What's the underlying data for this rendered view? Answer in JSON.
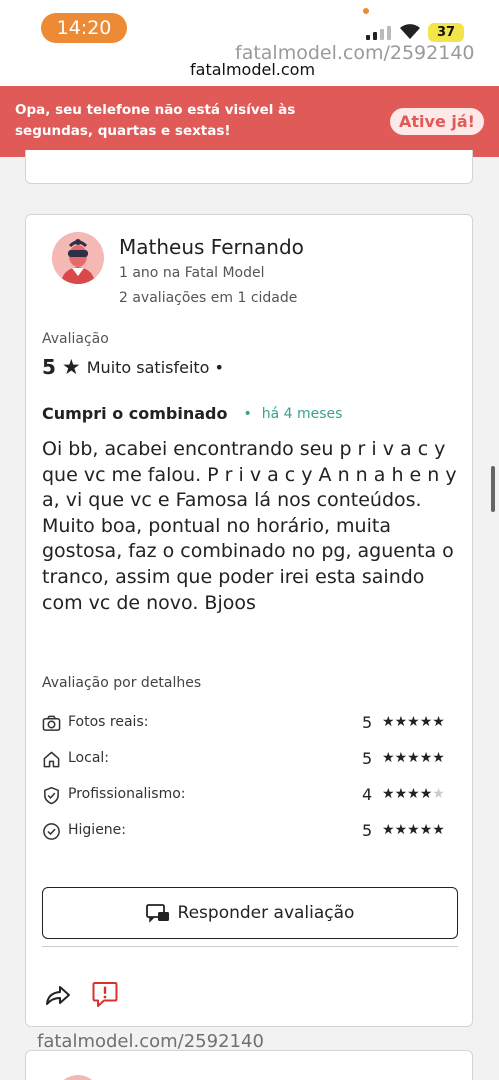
{
  "status_bar": {
    "time": "14:20",
    "battery": "37"
  },
  "watermark": {
    "top": "fatalmodel.com/2592140",
    "bottom": "fatalmodel.com/2592140"
  },
  "header": {
    "url": "fatalmodel.com"
  },
  "alert": {
    "message": "Opa, seu telefone não está visível às segundas, quartas e sextas!",
    "button": "Ative já!",
    "background": "#e05a58"
  },
  "review": {
    "user": {
      "name": "Matheus Fernando",
      "since": "1 ano na Fatal Model",
      "reviews": "2 avaliações em 1 cidade"
    },
    "rating_label": "Avaliação",
    "rating_value": "5",
    "rating_text": "Muito satisfeito •",
    "title": "Cumpri o combinado",
    "time": "há 4 meses",
    "body": "Oi bb, acabei encontrando seu p r i v a c y que vc me falou. P r i v a c y A n n a h e n y a, vi que vc e Famosa lá nos conteúdos. Muito boa, pontual no horário, muita gostosa, faz o combinado no pg, aguenta o tranco, assim que poder irei esta saindo com vc de novo. Bjoos",
    "details_title": "Avaliação por detalhes",
    "details": [
      {
        "label": "Fotos reais:",
        "score": "5",
        "stars": 5,
        "icon": "camera-icon"
      },
      {
        "label": "Local:",
        "score": "5",
        "stars": 5,
        "icon": "home-icon"
      },
      {
        "label": "Profissionalismo:",
        "score": "4",
        "stars": 4,
        "icon": "shield-check-icon"
      },
      {
        "label": "Higiene:",
        "score": "5",
        "stars": 5,
        "icon": "check-circle-icon"
      }
    ],
    "reply_button": "Responder avaliação"
  },
  "colors": {
    "accent_green": "#3aa18e",
    "report_red": "#d9302c",
    "time_pill": "#ec8a35"
  }
}
